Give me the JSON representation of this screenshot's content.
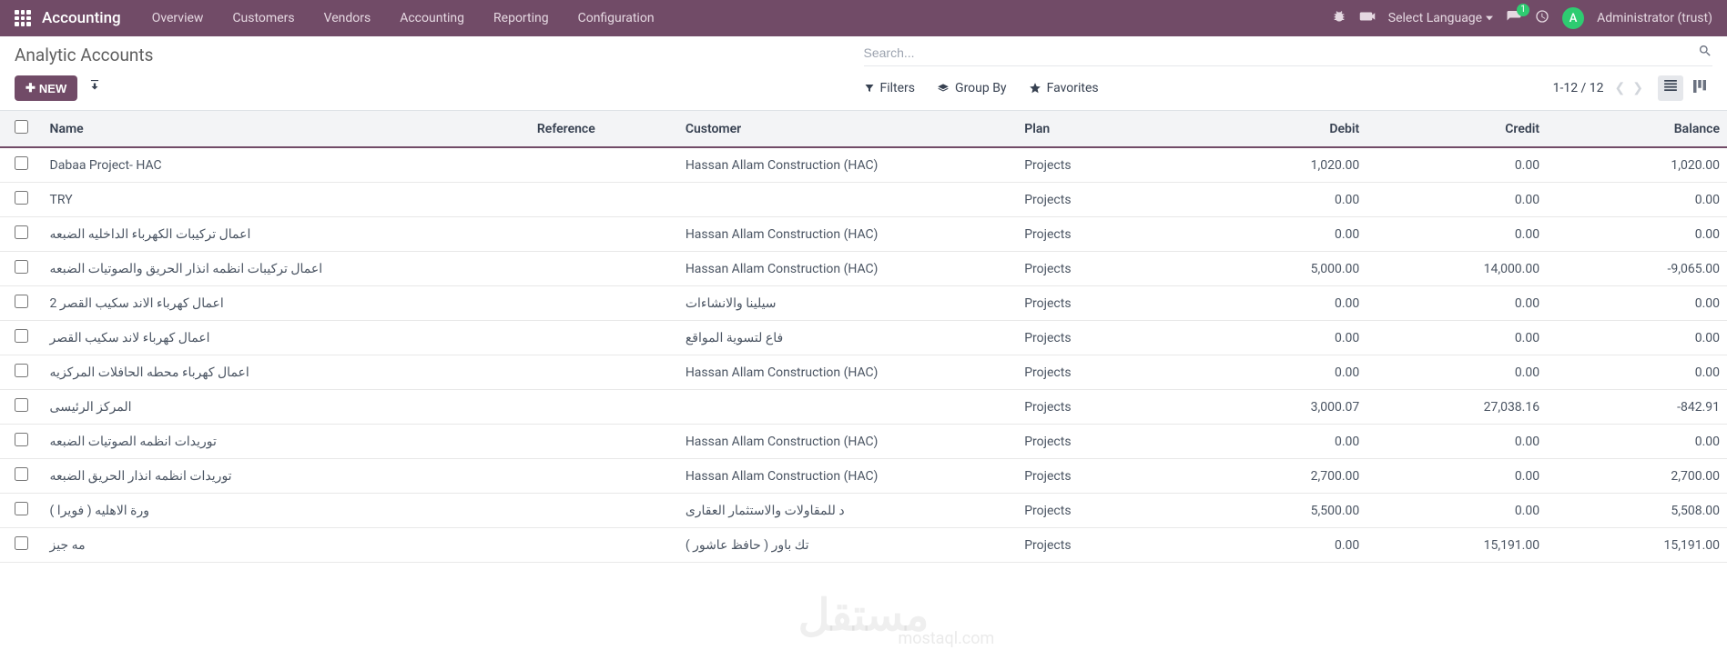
{
  "nav": {
    "app": "Accounting",
    "items": [
      "Overview",
      "Customers",
      "Vendors",
      "Accounting",
      "Reporting",
      "Configuration"
    ],
    "lang": "Select Language",
    "msg_count": "1",
    "avatar_letter": "A",
    "user": "Administrator (trust)"
  },
  "cp": {
    "breadcrumb": "Analytic Accounts",
    "search_ph": "Search...",
    "new_label": "NEW",
    "filters": "Filters",
    "groupby": "Group By",
    "favorites": "Favorites",
    "pager": "1-12 / 12"
  },
  "columns": {
    "name": "Name",
    "reference": "Reference",
    "customer": "Customer",
    "plan": "Plan",
    "debit": "Debit",
    "credit": "Credit",
    "balance": "Balance"
  },
  "rows": [
    {
      "name": "Dabaa Project- HAC",
      "ref": "",
      "cust": "Hassan Allam Construction (HAC)",
      "plan": "Projects",
      "debit": "1,020.00",
      "credit": "0.00",
      "balance": "1,020.00"
    },
    {
      "name": "TRY",
      "ref": "",
      "cust": "",
      "plan": "Projects",
      "debit": "0.00",
      "credit": "0.00",
      "balance": "0.00"
    },
    {
      "name": "اعمال تركيبات الكهرباء الداخليه الضبعه",
      "ref": "",
      "cust": "Hassan Allam Construction (HAC)",
      "plan": "Projects",
      "debit": "0.00",
      "credit": "0.00",
      "balance": "0.00"
    },
    {
      "name": "اعمال تركيبات انظمه انذار الحريق والصوتيات الضبعه",
      "ref": "",
      "cust": "Hassan Allam Construction (HAC)",
      "plan": "Projects",
      "debit": "5,000.00",
      "credit": "14,000.00",
      "balance": "-9,065.00"
    },
    {
      "name": "اعمال كهرباء الاند سكيب القصر 2",
      "ref": "",
      "cust": "سيلينا والانشاءات",
      "plan": "Projects",
      "debit": "0.00",
      "credit": "0.00",
      "balance": "0.00"
    },
    {
      "name": "اعمال كهرباء لاند سكيب القصر",
      "ref": "",
      "cust": "فاع لتسوية المواقع",
      "plan": "Projects",
      "debit": "0.00",
      "credit": "0.00",
      "balance": "0.00"
    },
    {
      "name": "اعمال كهرباء محطه الحافلات المركزيه",
      "ref": "",
      "cust": "Hassan Allam Construction (HAC)",
      "plan": "Projects",
      "debit": "0.00",
      "credit": "0.00",
      "balance": "0.00"
    },
    {
      "name": "المركز الرئيسى",
      "ref": "",
      "cust": "",
      "plan": "Projects",
      "debit": "3,000.07",
      "credit": "27,038.16",
      "balance": "-842.91"
    },
    {
      "name": "توريدات انظمه الصوتيات الضبعه",
      "ref": "",
      "cust": "Hassan Allam Construction (HAC)",
      "plan": "Projects",
      "debit": "0.00",
      "credit": "0.00",
      "balance": "0.00"
    },
    {
      "name": "توريدات انظمه انذار الحريق الضبعه",
      "ref": "",
      "cust": "Hassan Allam Construction (HAC)",
      "plan": "Projects",
      "debit": "2,700.00",
      "credit": "0.00",
      "balance": "2,700.00"
    },
    {
      "name": "ورة الاهليه ( فويرا )",
      "ref": "",
      "cust": "د للمقاولات والاستثمار العقارى",
      "plan": "Projects",
      "debit": "5,500.00",
      "credit": "0.00",
      "balance": "5,508.00"
    },
    {
      "name": "مه جيز",
      "ref": "",
      "cust": "تك باور ( حافظ عاشور )",
      "plan": "Projects",
      "debit": "0.00",
      "credit": "15,191.00",
      "balance": "15,191.00"
    }
  ],
  "watermark": {
    "main": "مستقل",
    "sub": "mostaql.com"
  }
}
